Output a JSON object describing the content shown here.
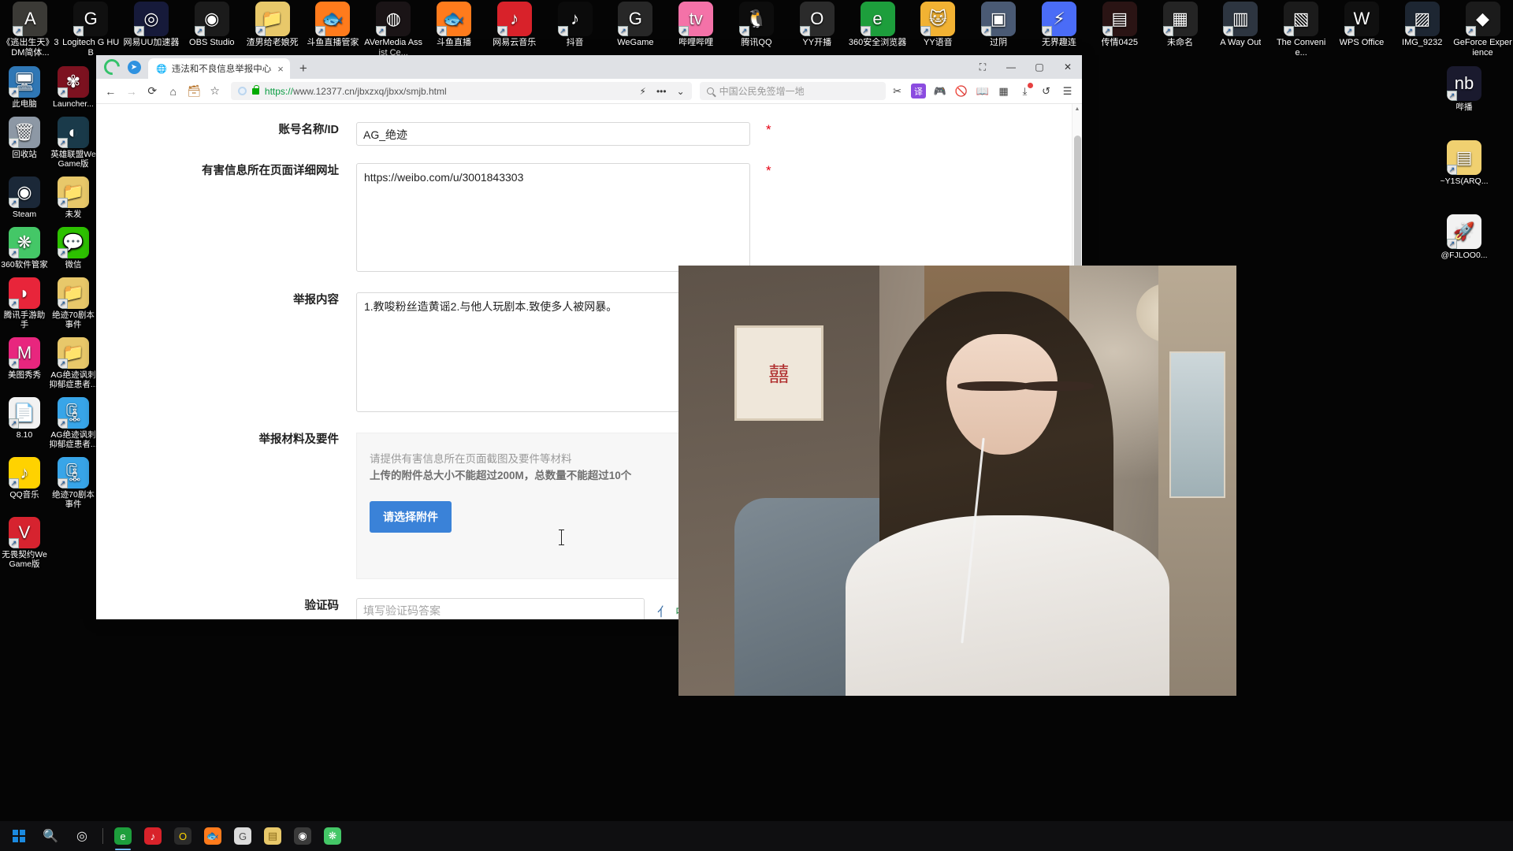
{
  "desktop": {
    "top_row_icons": [
      {
        "label": "《逃出生天》3DM简体...",
        "icon": "a-way-out-game-icon",
        "color": "#3b3a36",
        "glyph": "A"
      },
      {
        "label": "Logitech G HUB",
        "icon": "logitech-g-hub-icon",
        "color": "#101010",
        "glyph": "G"
      },
      {
        "label": "网易UU加速器",
        "icon": "netease-uu-accelerator-icon",
        "color": "#161a3a",
        "glyph": "◎"
      },
      {
        "label": "OBS Studio",
        "icon": "obs-studio-icon",
        "color": "#1b1b1b",
        "glyph": "◉"
      },
      {
        "label": "渣男给老娘死",
        "icon": "folder-icon",
        "color": "#e8c86a",
        "glyph": "📁"
      },
      {
        "label": "斗鱼直播管家",
        "icon": "douyu-live-assistant-icon",
        "color": "#ff7b1c",
        "glyph": "🐟"
      },
      {
        "label": "AVerMedia Assist Ce...",
        "icon": "avermedia-assist-center-icon",
        "color": "#1a1416",
        "glyph": "◍"
      },
      {
        "label": "斗鱼直播",
        "icon": "douyu-live-icon",
        "color": "#ff7b1c",
        "glyph": "🐟"
      },
      {
        "label": "网易云音乐",
        "icon": "netease-cloud-music-icon",
        "color": "#d8222a",
        "glyph": "♪"
      },
      {
        "label": "抖音",
        "icon": "douyin-icon",
        "color": "#0b0b0b",
        "glyph": "♪"
      },
      {
        "label": "WeGame",
        "icon": "wegame-icon",
        "color": "#272727",
        "glyph": "G"
      },
      {
        "label": "哔哩哔哩",
        "icon": "bilibili-icon",
        "color": "#f472a8",
        "glyph": "tv"
      },
      {
        "label": "腾讯QQ",
        "icon": "tencent-qq-icon",
        "color": "#0d0d0d",
        "glyph": "🐧"
      },
      {
        "label": "YY开播",
        "icon": "yy-broadcast-icon",
        "color": "#2b2b2b",
        "glyph": "O"
      },
      {
        "label": "360安全浏览器",
        "icon": "360-safe-browser-icon",
        "color": "#1d9e3c",
        "glyph": "e"
      },
      {
        "label": "YY语音",
        "icon": "yy-voice-icon",
        "color": "#f2b233",
        "glyph": "🐱"
      },
      {
        "label": "过阴",
        "icon": "guoyin-image-icon",
        "color": "#4a5a74",
        "glyph": "▣"
      },
      {
        "label": "无界趣连",
        "icon": "wujie-qulian-icon",
        "color": "#4a6cf7",
        "glyph": "⚡"
      },
      {
        "label": "传情0425",
        "icon": "chuanqing-image-icon",
        "color": "#2a1414",
        "glyph": "▤"
      },
      {
        "label": "未命名",
        "icon": "unnamed-image-icon",
        "color": "#242424",
        "glyph": "▦"
      },
      {
        "label": "A Way Out",
        "icon": "a-way-out-icon",
        "color": "#2d3540",
        "glyph": "▥"
      },
      {
        "label": "The Convenie...",
        "icon": "the-convenience-icon",
        "color": "#1b1b1b",
        "glyph": "▧"
      },
      {
        "label": "WPS Office",
        "icon": "wps-office-icon",
        "color": "#101010",
        "glyph": "W"
      },
      {
        "label": "IMG_9232",
        "icon": "img-9232-icon",
        "color": "#1d2632",
        "glyph": "▨"
      },
      {
        "label": "GeForce Experience",
        "icon": "geforce-experience-icon",
        "color": "#1b1b1b",
        "glyph": "◆"
      }
    ],
    "left_icons": [
      {
        "label": "此电脑",
        "icon": "this-pc-icon",
        "color": "#2f77b5",
        "glyph": "🖥"
      },
      {
        "label": "Launcher...",
        "icon": "naraka-launcher-icon",
        "color": "#7d1220",
        "glyph": "✾"
      },
      {
        "label": "回收站",
        "icon": "recycle-bin-icon",
        "color": "#8d98a5",
        "glyph": "🗑"
      },
      {
        "label": "英雄联盟WeGame版",
        "icon": "league-of-legends-wegame-icon",
        "color": "#1a3a4a",
        "glyph": "◐"
      },
      {
        "label": "Steam",
        "icon": "steam-icon",
        "color": "#1b2838",
        "glyph": "◉"
      },
      {
        "label": "未发",
        "icon": "folder-icon",
        "color": "#e8c86a",
        "glyph": "📁"
      },
      {
        "label": "360软件管家",
        "icon": "360-software-manager-icon",
        "color": "#44c767",
        "glyph": "❋"
      },
      {
        "label": "微信",
        "icon": "wechat-icon",
        "color": "#2dc100",
        "glyph": "💬"
      },
      {
        "label": "腾讯手游助手",
        "icon": "tencent-mobile-game-assistant-icon",
        "color": "#e8253a",
        "glyph": "◗"
      },
      {
        "label": "绝迹70剧本事件",
        "icon": "folder-icon",
        "color": "#e8c86a",
        "glyph": "📁"
      },
      {
        "label": "美图秀秀",
        "icon": "meitu-xiuxiu-icon",
        "color": "#e8267e",
        "glyph": "M"
      },
      {
        "label": "AG绝迹讽刺抑郁症患者...",
        "icon": "folder-icon",
        "color": "#e8c86a",
        "glyph": "📁"
      },
      {
        "label": "8.10",
        "icon": "document-image-icon",
        "color": "#f2f2f2",
        "glyph": "📄"
      },
      {
        "label": "AG绝迹讽刺抑郁症患者...",
        "icon": "360-zip-archive-icon",
        "color": "#38a5e8",
        "glyph": "🗜"
      },
      {
        "label": "QQ音乐",
        "icon": "qq-music-icon",
        "color": "#ffd200",
        "glyph": "♪"
      },
      {
        "label": "绝迹70剧本事件",
        "icon": "360-zip-archive-icon",
        "color": "#38a5e8",
        "glyph": "🗜"
      },
      {
        "label": "无畏契约WeGame版",
        "icon": "valorant-wegame-icon",
        "color": "#d6232f",
        "glyph": "V"
      }
    ],
    "right_icons": [
      {
        "label": "哔播",
        "icon": "bibo-icon",
        "color": "#1a1a2e",
        "glyph": "nb"
      },
      {
        "label": "~Y1S(ARQ...",
        "icon": "archive-file-icon",
        "color": "#f0d070",
        "glyph": "▤"
      },
      {
        "label": "@FJLOO0...",
        "icon": "rocket-file-icon",
        "color": "#f2f2f2",
        "glyph": "🚀"
      }
    ]
  },
  "taskbar": {
    "start_label": "start-button",
    "items": [
      {
        "icon": "windows-start-icon",
        "color": "#1b8ae0"
      },
      {
        "icon": "search-icon",
        "color": "transparent"
      },
      {
        "icon": "cortana-icon",
        "color": "transparent"
      },
      {
        "icon": "task-view-icon",
        "color": "transparent"
      },
      {
        "icon": "360-safe-browser-icon",
        "color": "#1d9e3c"
      },
      {
        "icon": "netease-cloud-music-icon",
        "color": "#d8222a"
      },
      {
        "icon": "yy-broadcast-icon",
        "color": "#2b2b2b"
      },
      {
        "icon": "douyu-live-icon",
        "color": "#ff7b1c"
      },
      {
        "icon": "chrome-icon",
        "color": "#dcdcdc"
      },
      {
        "icon": "folder-icon",
        "color": "#e8c86a"
      },
      {
        "icon": "obs-studio-icon",
        "color": "#3a3a3a"
      },
      {
        "icon": "360-software-manager-icon",
        "color": "#44c767"
      }
    ]
  },
  "browser": {
    "logo_icon": "360-browser-logo-icon",
    "telegram_icon": "telegram-icon",
    "tab": {
      "favicon": "globe-icon",
      "title": "违法和不良信息举报中心",
      "close_label": "×"
    },
    "new_tab_label": "+",
    "window_controls": {
      "extra": "⛶",
      "minimize": "—",
      "maximize": "▢",
      "close": "✕"
    },
    "nav": {
      "back": "back-icon",
      "forward": "forward-icon",
      "reload": "reload-icon",
      "home": "home-icon",
      "briefcase": "briefcase-icon",
      "collect": "add-favorite-icon"
    },
    "address": {
      "scheme": "https://",
      "rest": "www.12377.cn/jbxzxq/jbxx/smjb.html",
      "full": "https://www.12377.cn/jbxzxq/jbxx/smjb.html",
      "lock_icon": "lock-icon",
      "shield_icon": "shield-icon"
    },
    "omnibox_right": {
      "lightning": "⚡",
      "more": "•••",
      "chevron": "⌄"
    },
    "search": {
      "placeholder": "中国公民免签增一地",
      "icon": "search-icon"
    },
    "toolbar_icons": [
      {
        "name": "screenshot-scissors-icon",
        "glyph": "✂",
        "color": "#3a3a3a",
        "bg": "transparent"
      },
      {
        "name": "translate-icon",
        "glyph": "译",
        "color": "#ffffff",
        "bg": "#8b4ce0"
      },
      {
        "name": "game-controller-icon",
        "glyph": "🎮",
        "color": "#ff7b1c",
        "bg": "transparent"
      },
      {
        "name": "block-ads-icon",
        "glyph": "🚫",
        "color": "#e03a3a",
        "bg": "transparent"
      },
      {
        "name": "reading-mode-icon",
        "glyph": "📖",
        "color": "#5a5a5a",
        "bg": "transparent"
      },
      {
        "name": "apps-grid-icon",
        "glyph": "▦",
        "color": "#3a3a3a",
        "bg": "transparent"
      },
      {
        "name": "downloads-icon",
        "glyph": "⤓",
        "color": "#3a3a3a",
        "bg": "transparent",
        "badge": true
      },
      {
        "name": "undo-icon",
        "glyph": "↺",
        "color": "#3a3a3a",
        "bg": "transparent"
      },
      {
        "name": "menu-icon",
        "glyph": "☰",
        "color": "#3a3a3a",
        "bg": "transparent"
      }
    ]
  },
  "form": {
    "rows": [
      {
        "label": "账号名称/ID",
        "type": "input",
        "value": "AG_绝迹",
        "required": true,
        "required_mark": "*"
      },
      {
        "label": "有害信息所在页面详细网址",
        "type": "textarea-url",
        "value": "https://weibo.com/u/3001843303",
        "required": true,
        "required_mark": "*"
      },
      {
        "label": "举报内容",
        "type": "textarea-content",
        "value": "1.教唆粉丝造黄谣2.与他人玩剧本.致使多人被网暴。",
        "required": false,
        "required_mark": ""
      },
      {
        "label": "举报材料及要件",
        "type": "upload",
        "required": false,
        "required_mark": ""
      },
      {
        "label": "验证码",
        "type": "captcha",
        "placeholder": "填写验证码答案",
        "required": false,
        "required_mark": ""
      }
    ],
    "upload": {
      "hint_line1": "请提供有害信息所在页面截图及要件等材料",
      "hint_line2": "上传的附件总大小不能超过200M，总数量不能超过10个",
      "button_label": "请选择附件"
    },
    "captcha": {
      "placeholder": "填写验证码答案",
      "icons": [
        "captcha-char-1",
        "captcha-char-2",
        "captcha-char-3"
      ]
    }
  },
  "video_overlay": {
    "name": "live-stream-video-overlay"
  },
  "colors": {
    "accent_blue": "#3a82d8",
    "required_red": "#e60012",
    "url_green": "#0a9c42",
    "tab_bg": "#dfe1e5"
  }
}
